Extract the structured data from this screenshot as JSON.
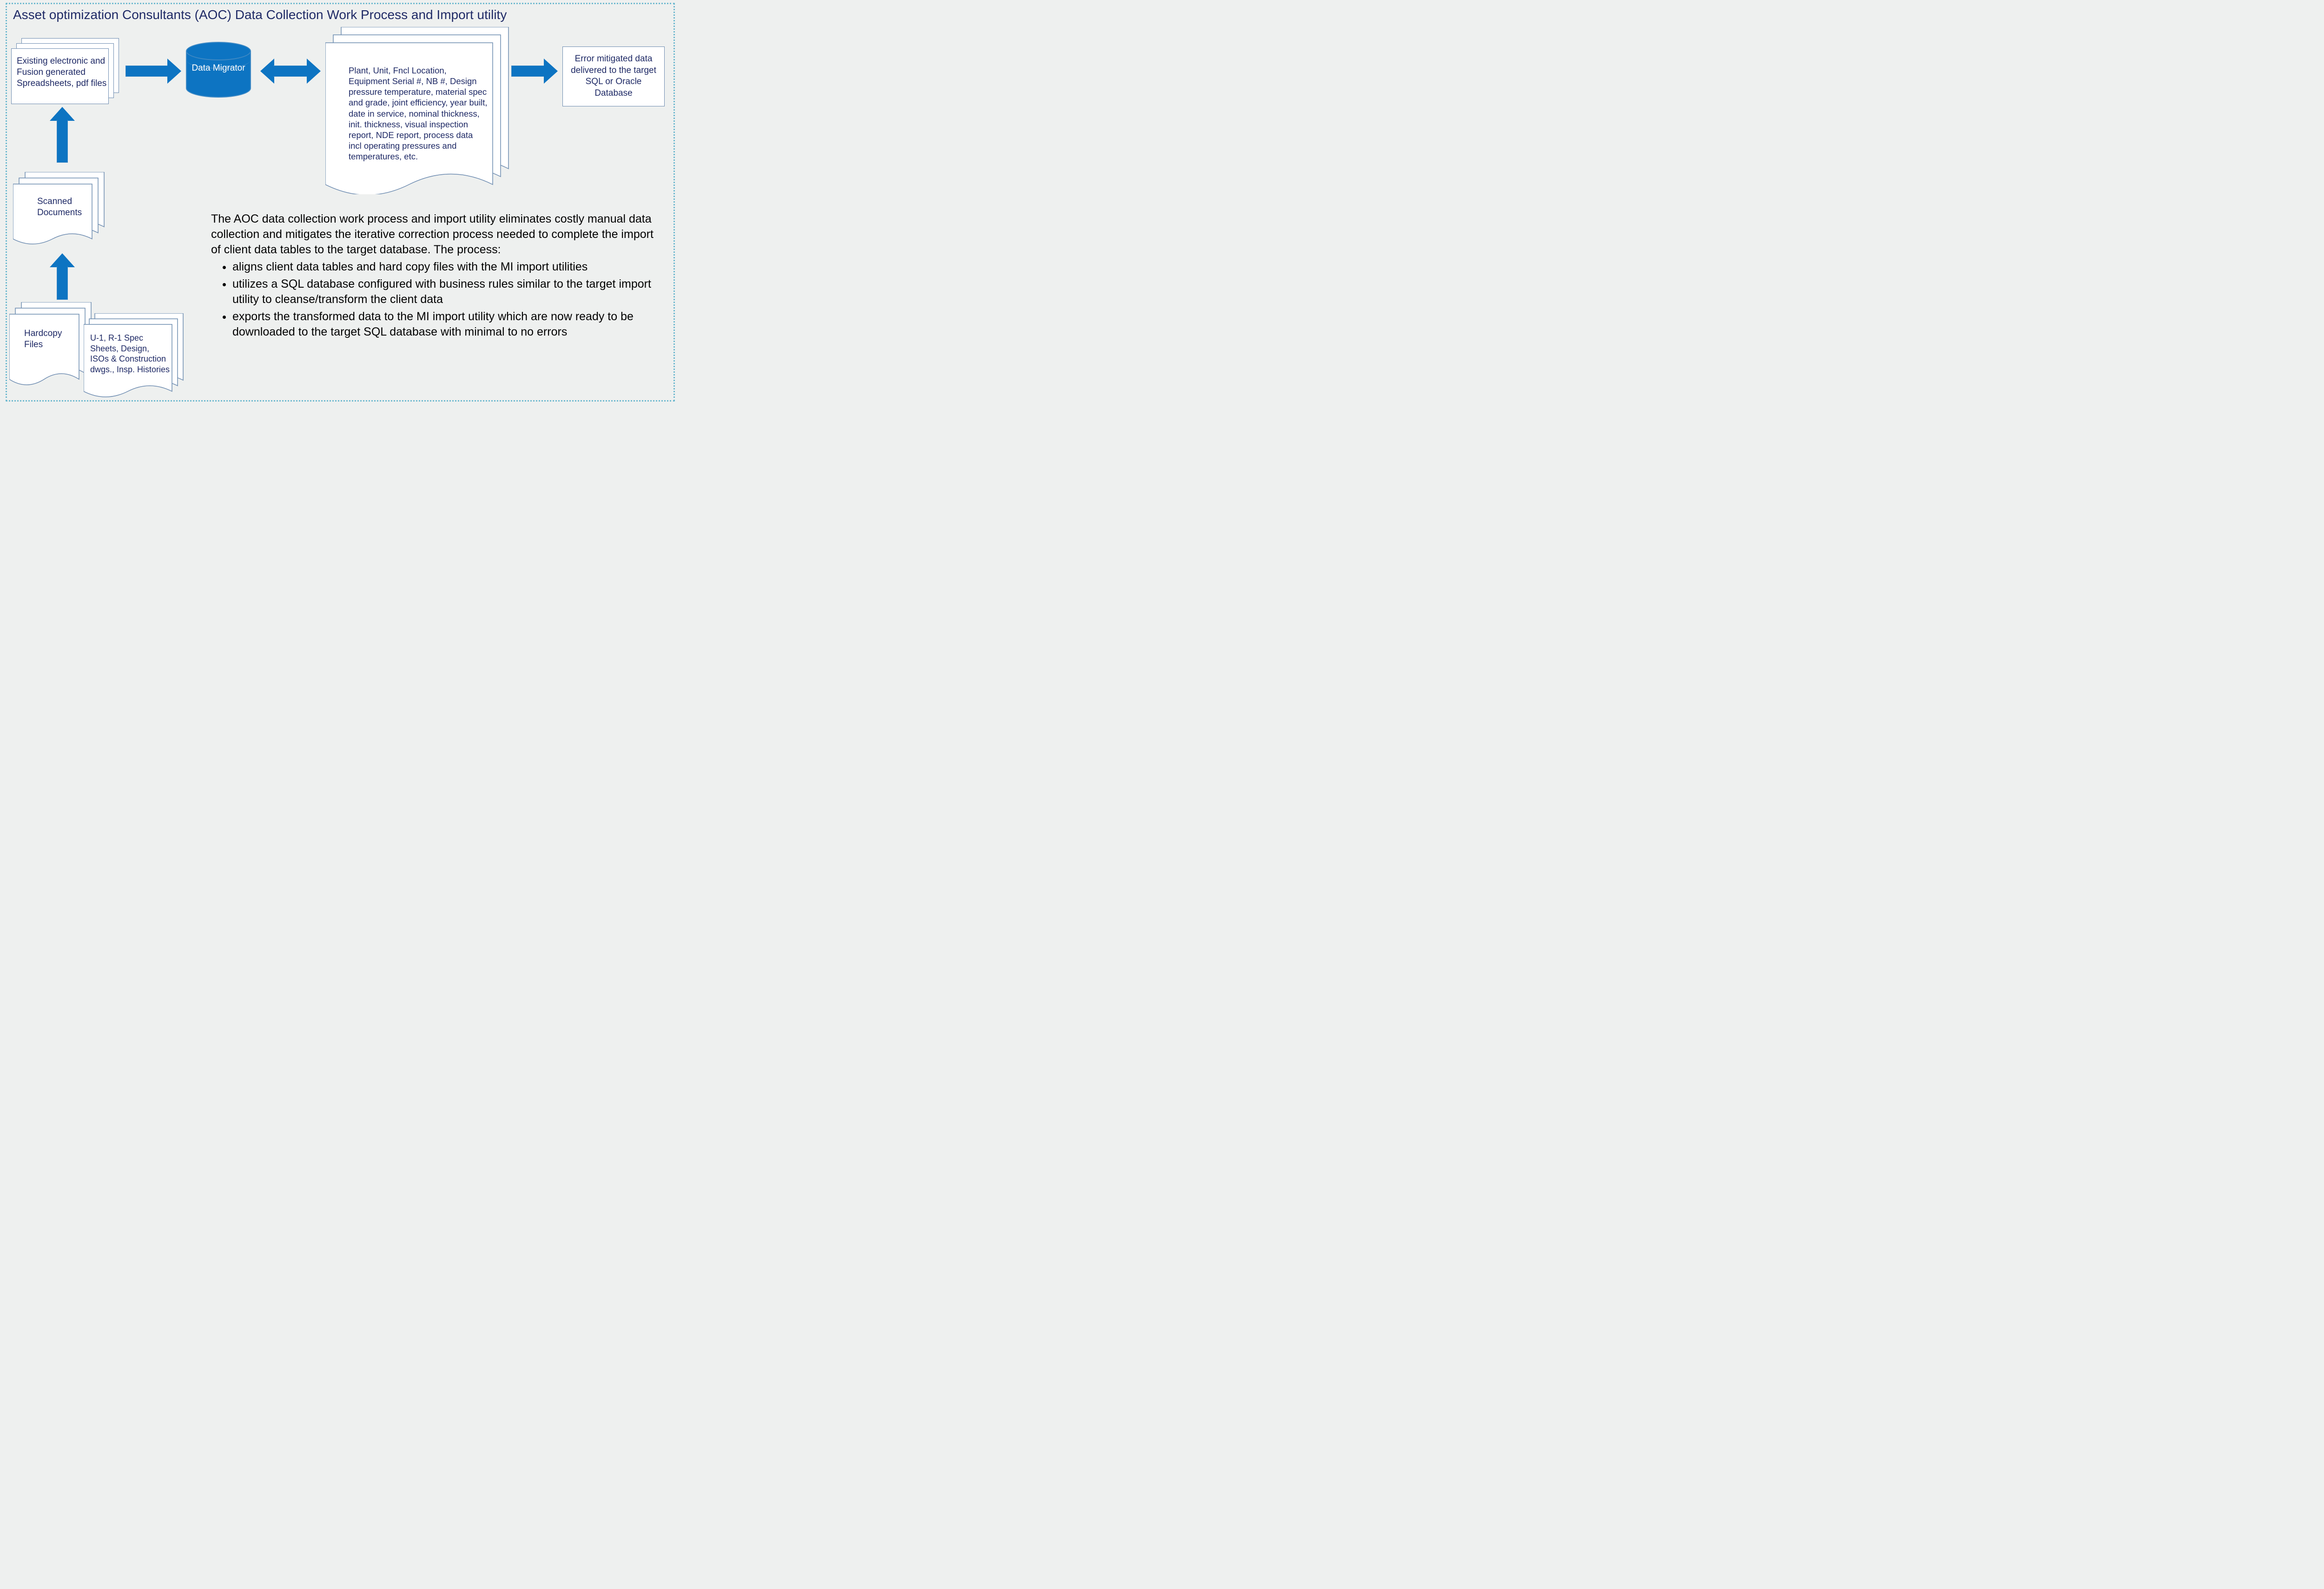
{
  "title": "Asset optimization Consultants (AOC) Data Collection Work Process and Import utility",
  "nodes": {
    "spreadsheets": "Existing electronic and Fusion generated Spreadsheets, pdf files",
    "scanned": "Scanned Documents",
    "hardcopy": "Hardcopy Files",
    "specs": "U-1, R-1 Spec Sheets, Design, ISOs & Construction dwgs., Insp. Histories",
    "db": "Data Migrator",
    "fields": "Plant, Unit, Fncl Location, Equipment Serial #, NB #, Design pressure temperature, material spec and grade, joint efficiency, year built, date in service, nominal thickness, init. thickness, visual inspection report, NDE report, process data incl operating pressures and temperatures, etc.",
    "output": "Error mitigated data delivered to the target SQL or Oracle Database"
  },
  "desc": {
    "intro": "The AOC data collection work process and import utility eliminates costly manual data collection and mitigates the iterative correction process needed to complete the import of client data tables to the target database. The process:",
    "b1": "aligns client data tables and hard copy files with the MI import utilities",
    "b2": "utilizes a SQL database configured with business rules similar to the target import utility to cleanse/transform the client data",
    "b3": "exports the transformed data to the MI import utility which are now ready to be downloaded to the target SQL database with minimal to no errors"
  }
}
